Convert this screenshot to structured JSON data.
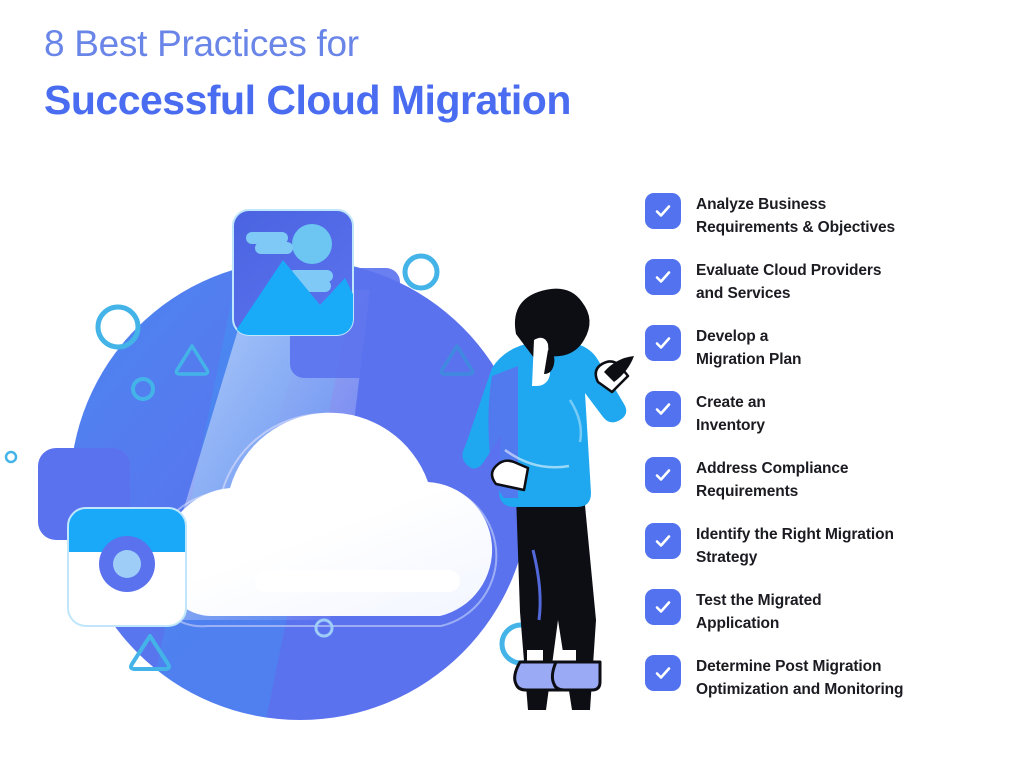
{
  "title": {
    "line1": "8 Best Practices for",
    "line2": "Successful Cloud Migration",
    "line1_color": "#6a85e8",
    "line2_color": "#4a6cf0"
  },
  "checklist": {
    "checkbox_color": "#5272f0",
    "check_color": "#ffffff",
    "text_color": "#1b1b22",
    "items": [
      {
        "line1": "Analyze Business",
        "line2": "Requirements & Objectives",
        "icon": "check-icon"
      },
      {
        "line1": "Evaluate Cloud Providers",
        "line2": "and Services",
        "icon": "check-icon"
      },
      {
        "line1": "Develop a",
        "line2": "Migration Plan",
        "icon": "check-icon"
      },
      {
        "line1": "Create an",
        "line2": "Inventory",
        "icon": "check-icon"
      },
      {
        "line1": "Address Compliance",
        "line2": "Requirements",
        "icon": "check-icon"
      },
      {
        "line1": "Identify the Right Migration",
        "line2": "Strategy",
        "icon": "check-icon"
      },
      {
        "line1": "Test the Migrated",
        "line2": "Application",
        "icon": "check-icon"
      },
      {
        "line1": "Determine Post Migration",
        "line2": "Optimization and Monitoring",
        "icon": "check-icon"
      }
    ]
  },
  "illustration": {
    "name": "cloud-migration-illustration",
    "colors": {
      "circle_blue": "#5b72ee",
      "cloud_white": "#ffffff",
      "accent_cyan": "#44b4e8",
      "card_blue": "#2196f3",
      "card_dark_blue": "#4a63e0",
      "sweater_blue": "#1fa8f0",
      "pants_black": "#0d0d14",
      "shoe_blue": "#9aaaf5",
      "light_blue": "#7ec9f5",
      "sun_blue": "#6dc5f2"
    },
    "elements": [
      {
        "name": "background-circle",
        "type": "circle"
      },
      {
        "name": "cloud-shape",
        "type": "cloud"
      },
      {
        "name": "cloud-bar",
        "type": "pill"
      },
      {
        "name": "image-card",
        "type": "card",
        "icon": "photo-icon"
      },
      {
        "name": "camera-card",
        "type": "card",
        "icon": "camera-icon"
      },
      {
        "name": "person-figure",
        "type": "person"
      },
      {
        "name": "decor-circle-large",
        "type": "ring"
      },
      {
        "name": "decor-circle-small",
        "type": "ring"
      },
      {
        "name": "decor-circle-tiny",
        "type": "ring"
      },
      {
        "name": "decor-circle-top",
        "type": "ring"
      },
      {
        "name": "decor-circle-bottom",
        "type": "ring"
      },
      {
        "name": "decor-triangle-left",
        "type": "triangle"
      },
      {
        "name": "decor-triangle-right",
        "type": "triangle"
      },
      {
        "name": "decor-triangle-bottom",
        "type": "triangle"
      }
    ]
  }
}
